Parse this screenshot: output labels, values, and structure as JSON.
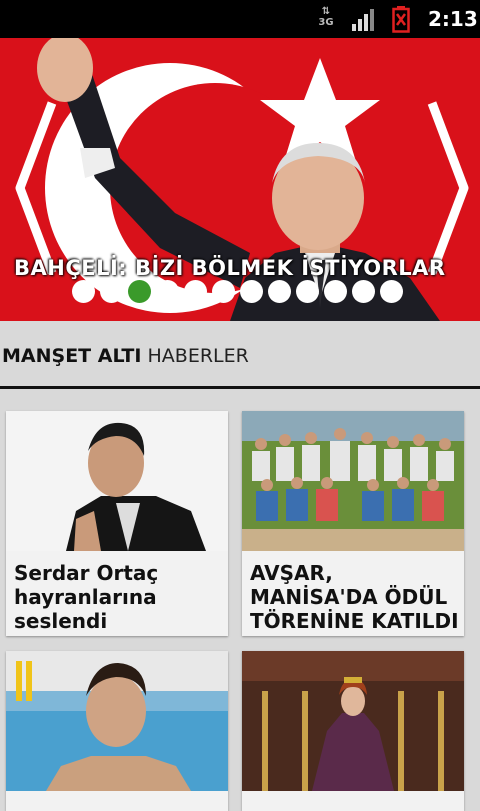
{
  "status_bar": {
    "network": "3G",
    "time": "2:13"
  },
  "hero": {
    "title": "BAHÇELİ: BİZİ BÖLMEK İSTİYORLAR",
    "dots_total": 12,
    "dots_active_index": 2
  },
  "section": {
    "title_bold": "MANŞET ALTI",
    "title_light": "HABERLER"
  },
  "cards": [
    {
      "caption": "Serdar Ortaç hayranlarına seslendi"
    },
    {
      "caption": "AVŞAR, MANİSA'DA ÖDÜL TÖRENİNE KATILDI"
    },
    {
      "caption": ""
    },
    {
      "caption": ""
    }
  ],
  "colors": {
    "flag_red": "#d9111a",
    "dot_active": "#3a9a2a",
    "background": "#d9d9d9"
  }
}
